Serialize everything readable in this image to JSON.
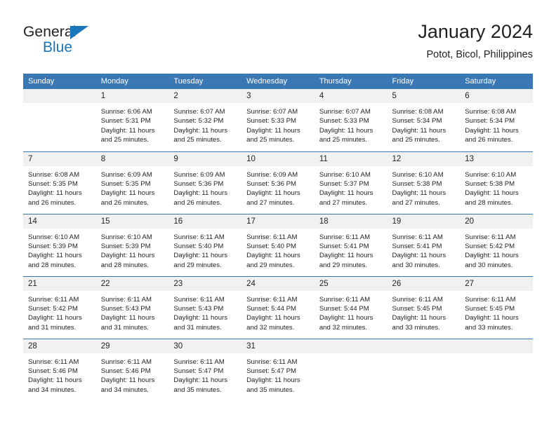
{
  "brand": {
    "word1": "General",
    "word2": "Blue",
    "triangle_color": "#1b75bb",
    "icon": "triangle-icon"
  },
  "header": {
    "title": "January 2024",
    "subtitle": "Potot, Bicol, Philippines"
  },
  "colors": {
    "header_blue": "#3a77b5",
    "daynum_band": "#f1f1f1",
    "text": "#231f20",
    "brand_blue": "#1b75bb"
  },
  "calendar": {
    "weekdays": [
      "Sunday",
      "Monday",
      "Tuesday",
      "Wednesday",
      "Thursday",
      "Friday",
      "Saturday"
    ],
    "weeks": [
      [
        {
          "day": "",
          "sunrise": "",
          "sunset": "",
          "daylight1": "",
          "daylight2": ""
        },
        {
          "day": "1",
          "sunrise": "Sunrise: 6:06 AM",
          "sunset": "Sunset: 5:31 PM",
          "daylight1": "Daylight: 11 hours",
          "daylight2": "and 25 minutes."
        },
        {
          "day": "2",
          "sunrise": "Sunrise: 6:07 AM",
          "sunset": "Sunset: 5:32 PM",
          "daylight1": "Daylight: 11 hours",
          "daylight2": "and 25 minutes."
        },
        {
          "day": "3",
          "sunrise": "Sunrise: 6:07 AM",
          "sunset": "Sunset: 5:33 PM",
          "daylight1": "Daylight: 11 hours",
          "daylight2": "and 25 minutes."
        },
        {
          "day": "4",
          "sunrise": "Sunrise: 6:07 AM",
          "sunset": "Sunset: 5:33 PM",
          "daylight1": "Daylight: 11 hours",
          "daylight2": "and 25 minutes."
        },
        {
          "day": "5",
          "sunrise": "Sunrise: 6:08 AM",
          "sunset": "Sunset: 5:34 PM",
          "daylight1": "Daylight: 11 hours",
          "daylight2": "and 25 minutes."
        },
        {
          "day": "6",
          "sunrise": "Sunrise: 6:08 AM",
          "sunset": "Sunset: 5:34 PM",
          "daylight1": "Daylight: 11 hours",
          "daylight2": "and 26 minutes."
        }
      ],
      [
        {
          "day": "7",
          "sunrise": "Sunrise: 6:08 AM",
          "sunset": "Sunset: 5:35 PM",
          "daylight1": "Daylight: 11 hours",
          "daylight2": "and 26 minutes."
        },
        {
          "day": "8",
          "sunrise": "Sunrise: 6:09 AM",
          "sunset": "Sunset: 5:35 PM",
          "daylight1": "Daylight: 11 hours",
          "daylight2": "and 26 minutes."
        },
        {
          "day": "9",
          "sunrise": "Sunrise: 6:09 AM",
          "sunset": "Sunset: 5:36 PM",
          "daylight1": "Daylight: 11 hours",
          "daylight2": "and 26 minutes."
        },
        {
          "day": "10",
          "sunrise": "Sunrise: 6:09 AM",
          "sunset": "Sunset: 5:36 PM",
          "daylight1": "Daylight: 11 hours",
          "daylight2": "and 27 minutes."
        },
        {
          "day": "11",
          "sunrise": "Sunrise: 6:10 AM",
          "sunset": "Sunset: 5:37 PM",
          "daylight1": "Daylight: 11 hours",
          "daylight2": "and 27 minutes."
        },
        {
          "day": "12",
          "sunrise": "Sunrise: 6:10 AM",
          "sunset": "Sunset: 5:38 PM",
          "daylight1": "Daylight: 11 hours",
          "daylight2": "and 27 minutes."
        },
        {
          "day": "13",
          "sunrise": "Sunrise: 6:10 AM",
          "sunset": "Sunset: 5:38 PM",
          "daylight1": "Daylight: 11 hours",
          "daylight2": "and 28 minutes."
        }
      ],
      [
        {
          "day": "14",
          "sunrise": "Sunrise: 6:10 AM",
          "sunset": "Sunset: 5:39 PM",
          "daylight1": "Daylight: 11 hours",
          "daylight2": "and 28 minutes."
        },
        {
          "day": "15",
          "sunrise": "Sunrise: 6:10 AM",
          "sunset": "Sunset: 5:39 PM",
          "daylight1": "Daylight: 11 hours",
          "daylight2": "and 28 minutes."
        },
        {
          "day": "16",
          "sunrise": "Sunrise: 6:11 AM",
          "sunset": "Sunset: 5:40 PM",
          "daylight1": "Daylight: 11 hours",
          "daylight2": "and 29 minutes."
        },
        {
          "day": "17",
          "sunrise": "Sunrise: 6:11 AM",
          "sunset": "Sunset: 5:40 PM",
          "daylight1": "Daylight: 11 hours",
          "daylight2": "and 29 minutes."
        },
        {
          "day": "18",
          "sunrise": "Sunrise: 6:11 AM",
          "sunset": "Sunset: 5:41 PM",
          "daylight1": "Daylight: 11 hours",
          "daylight2": "and 29 minutes."
        },
        {
          "day": "19",
          "sunrise": "Sunrise: 6:11 AM",
          "sunset": "Sunset: 5:41 PM",
          "daylight1": "Daylight: 11 hours",
          "daylight2": "and 30 minutes."
        },
        {
          "day": "20",
          "sunrise": "Sunrise: 6:11 AM",
          "sunset": "Sunset: 5:42 PM",
          "daylight1": "Daylight: 11 hours",
          "daylight2": "and 30 minutes."
        }
      ],
      [
        {
          "day": "21",
          "sunrise": "Sunrise: 6:11 AM",
          "sunset": "Sunset: 5:42 PM",
          "daylight1": "Daylight: 11 hours",
          "daylight2": "and 31 minutes."
        },
        {
          "day": "22",
          "sunrise": "Sunrise: 6:11 AM",
          "sunset": "Sunset: 5:43 PM",
          "daylight1": "Daylight: 11 hours",
          "daylight2": "and 31 minutes."
        },
        {
          "day": "23",
          "sunrise": "Sunrise: 6:11 AM",
          "sunset": "Sunset: 5:43 PM",
          "daylight1": "Daylight: 11 hours",
          "daylight2": "and 31 minutes."
        },
        {
          "day": "24",
          "sunrise": "Sunrise: 6:11 AM",
          "sunset": "Sunset: 5:44 PM",
          "daylight1": "Daylight: 11 hours",
          "daylight2": "and 32 minutes."
        },
        {
          "day": "25",
          "sunrise": "Sunrise: 6:11 AM",
          "sunset": "Sunset: 5:44 PM",
          "daylight1": "Daylight: 11 hours",
          "daylight2": "and 32 minutes."
        },
        {
          "day": "26",
          "sunrise": "Sunrise: 6:11 AM",
          "sunset": "Sunset: 5:45 PM",
          "daylight1": "Daylight: 11 hours",
          "daylight2": "and 33 minutes."
        },
        {
          "day": "27",
          "sunrise": "Sunrise: 6:11 AM",
          "sunset": "Sunset: 5:45 PM",
          "daylight1": "Daylight: 11 hours",
          "daylight2": "and 33 minutes."
        }
      ],
      [
        {
          "day": "28",
          "sunrise": "Sunrise: 6:11 AM",
          "sunset": "Sunset: 5:46 PM",
          "daylight1": "Daylight: 11 hours",
          "daylight2": "and 34 minutes."
        },
        {
          "day": "29",
          "sunrise": "Sunrise: 6:11 AM",
          "sunset": "Sunset: 5:46 PM",
          "daylight1": "Daylight: 11 hours",
          "daylight2": "and 34 minutes."
        },
        {
          "day": "30",
          "sunrise": "Sunrise: 6:11 AM",
          "sunset": "Sunset: 5:47 PM",
          "daylight1": "Daylight: 11 hours",
          "daylight2": "and 35 minutes."
        },
        {
          "day": "31",
          "sunrise": "Sunrise: 6:11 AM",
          "sunset": "Sunset: 5:47 PM",
          "daylight1": "Daylight: 11 hours",
          "daylight2": "and 35 minutes."
        },
        {
          "day": "",
          "sunrise": "",
          "sunset": "",
          "daylight1": "",
          "daylight2": ""
        },
        {
          "day": "",
          "sunrise": "",
          "sunset": "",
          "daylight1": "",
          "daylight2": ""
        },
        {
          "day": "",
          "sunrise": "",
          "sunset": "",
          "daylight1": "",
          "daylight2": ""
        }
      ]
    ]
  }
}
